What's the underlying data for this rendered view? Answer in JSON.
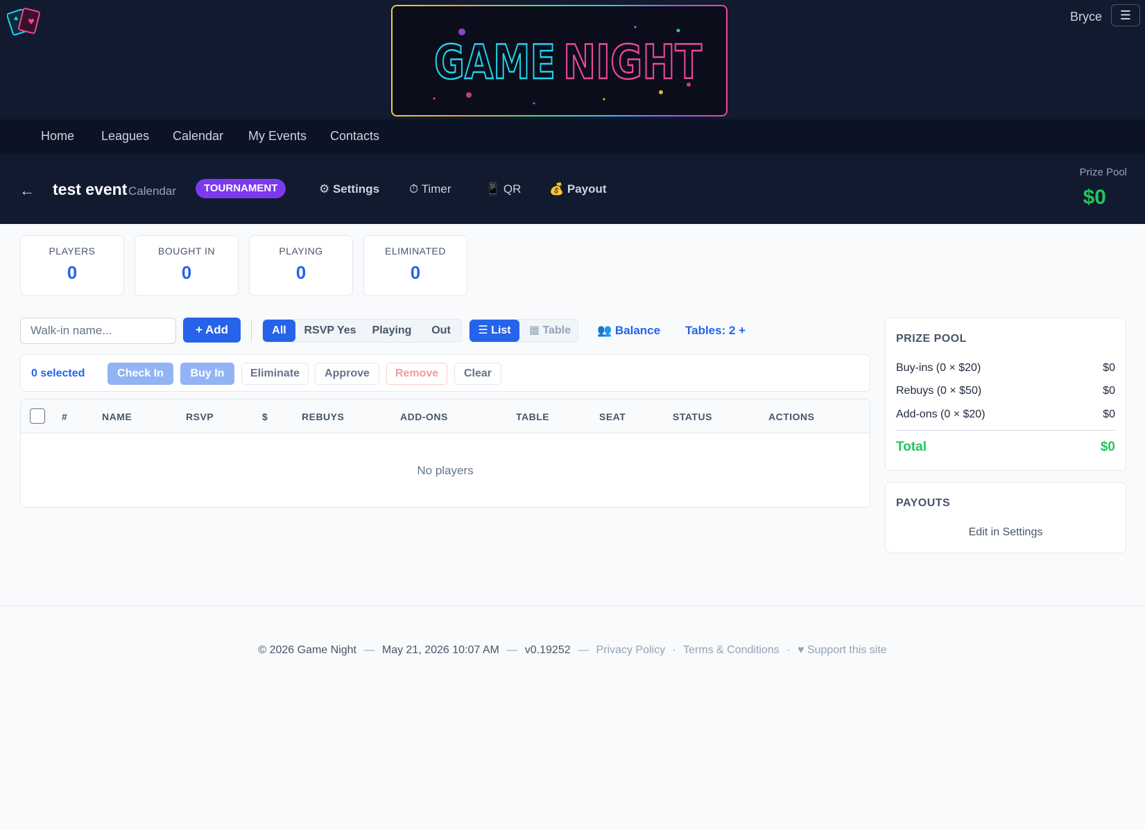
{
  "header": {
    "logo_icon": "playing-cards-icon",
    "banner_text_1": "GAME",
    "banner_text_2": "NIGHT",
    "user_name": "Bryce",
    "menu_icon": "☰"
  },
  "nav": {
    "items": [
      "Home",
      "Leagues",
      "Calendar",
      "My Events",
      "Contacts"
    ]
  },
  "event": {
    "back": "←",
    "title": "test event",
    "subtitle": "Calendar",
    "type_badge": "TOURNAMENT",
    "settings": "⚙ Settings",
    "timer": "⏱ Timer",
    "qr": "📱 QR",
    "payout": "💰 Payout",
    "prize_pool_label": "Prize Pool",
    "prize_pool_value": "$0"
  },
  "stats": [
    {
      "label": "PLAYERS",
      "value": "0"
    },
    {
      "label": "BOUGHT IN",
      "value": "0"
    },
    {
      "label": "PLAYING",
      "value": "0"
    },
    {
      "label": "ELIMINATED",
      "value": "0"
    }
  ],
  "toolbar": {
    "walkin_placeholder": "Walk-in name...",
    "add_label": "+ Add",
    "filters": [
      "All",
      "RSVP Yes",
      "Playing",
      "Out"
    ],
    "active_filter": "All",
    "views": [
      "☰ List",
      "▦ Table"
    ],
    "active_view": "☰ List",
    "balance_label": "👥 Balance",
    "tables_label": "Tables: 2 +"
  },
  "bulk": {
    "selected": "0 selected",
    "check_in": "Check In",
    "buy_in": "Buy In",
    "eliminate": "Eliminate",
    "approve": "Approve",
    "remove": "Remove",
    "clear": "Clear"
  },
  "table": {
    "columns": [
      "#",
      "NAME",
      "RSVP",
      "$",
      "REBUYS",
      "ADD-ONS",
      "TABLE",
      "SEAT",
      "STATUS",
      "ACTIONS"
    ],
    "empty_text": "No players"
  },
  "prize_pool_card": {
    "title": "PRIZE POOL",
    "rows": [
      {
        "label": "Buy-ins (0 × $20)",
        "amount": "$0"
      },
      {
        "label": "Rebuys (0 × $50)",
        "amount": "$0"
      },
      {
        "label": "Add-ons (0 × $20)",
        "amount": "$0"
      }
    ],
    "total_label": "Total",
    "total_amount": "$0"
  },
  "payouts_card": {
    "title": "PAYOUTS",
    "text": "Edit in Settings"
  },
  "footer": {
    "copyright": "© 2026 Game Night",
    "datetime": "May 21, 2026 10:07 AM",
    "version": "v0.19252",
    "privacy": "Privacy Policy",
    "terms": "Terms & Conditions",
    "support": "♥ Support this site"
  },
  "colors": {
    "accent": "#2563eb",
    "success": "#22c55e",
    "badge": "#7c3aed",
    "header_bg": "#111a2e"
  }
}
